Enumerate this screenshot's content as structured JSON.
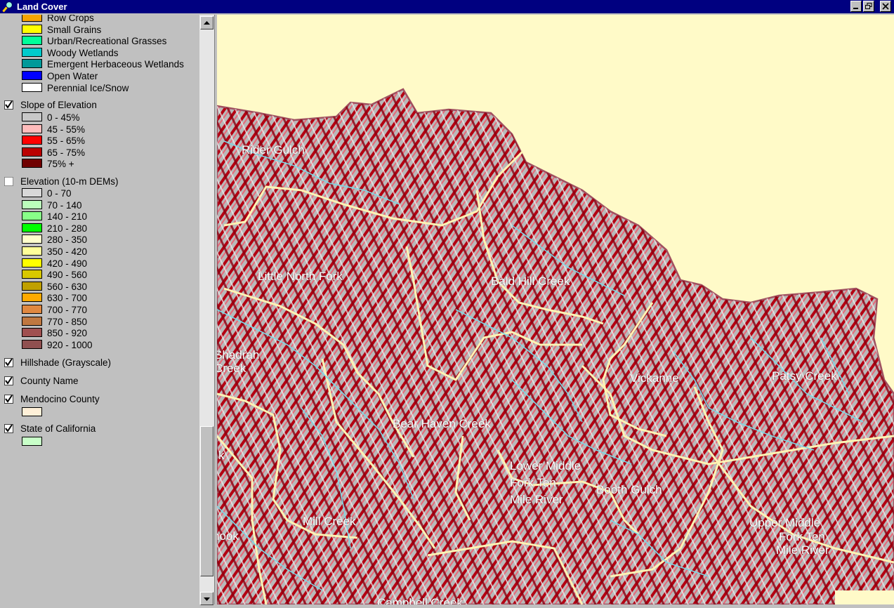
{
  "window": {
    "title": "Land Cover",
    "buttons": [
      "minimize",
      "restore",
      "close"
    ]
  },
  "legend": {
    "land_cover_classes": [
      {
        "label": "Row Crops",
        "color": "#f7a400"
      },
      {
        "label": "Small Grains",
        "color": "#ffff00"
      },
      {
        "label": "Urban/Recreational Grasses",
        "color": "#00ff99"
      },
      {
        "label": "Woody Wetlands",
        "color": "#00cccc"
      },
      {
        "label": "Emergent Herbaceous Wetlands",
        "color": "#009999"
      },
      {
        "label": "Open Water",
        "color": "#0000ff"
      },
      {
        "label": "Perennial Ice/Snow",
        "color": "#ffffff"
      }
    ],
    "layers": [
      {
        "name": "Slope of Elevation",
        "checked": true,
        "classes": [
          {
            "label": "0 - 45%",
            "color": "#c8c8c8"
          },
          {
            "label": "45 - 55%",
            "color": "#ffbcbc"
          },
          {
            "label": "55 - 65%",
            "color": "#ff0000"
          },
          {
            "label": "65 - 75%",
            "color": "#bb0000"
          },
          {
            "label": "75% +",
            "color": "#700000"
          }
        ]
      },
      {
        "name": "Elevation (10-m DEMs)",
        "checked": false,
        "classes": [
          {
            "label": "0 - 70",
            "color": "#d8d8d8"
          },
          {
            "label": "70 - 140",
            "color": "#bbffbb"
          },
          {
            "label": "140 - 210",
            "color": "#88ff88"
          },
          {
            "label": "210 - 280",
            "color": "#00ff00"
          },
          {
            "label": "280 - 350",
            "color": "#ffffcc"
          },
          {
            "label": "350 - 420",
            "color": "#ffff99"
          },
          {
            "label": "420 - 490",
            "color": "#ffff00"
          },
          {
            "label": "490 - 560",
            "color": "#d8c800"
          },
          {
            "label": "560 - 630",
            "color": "#c0a000"
          },
          {
            "label": "630 - 700",
            "color": "#ffaa00"
          },
          {
            "label": "700 - 770",
            "color": "#e08840"
          },
          {
            "label": "770 - 850",
            "color": "#c07840"
          },
          {
            "label": "850 - 920",
            "color": "#a05050"
          },
          {
            "label": "920 - 1000",
            "color": "#905050"
          }
        ]
      },
      {
        "name": "Hillshade (Grayscale)",
        "checked": true,
        "classes": []
      },
      {
        "name": "County Name",
        "checked": true,
        "classes": []
      },
      {
        "name": "Mendocino County",
        "checked": true,
        "classes": [
          {
            "label": "",
            "color": "#fff0d8"
          }
        ]
      },
      {
        "name": "State of California",
        "checked": true,
        "classes": [
          {
            "label": "",
            "color": "#c8ffc8"
          }
        ]
      }
    ]
  },
  "map": {
    "background_color": "#fffac8",
    "labels": [
      "Rider Gulch",
      "Little North Fork",
      "Bald Hill Creek",
      "Shadrah",
      "Creek",
      "Vickanne",
      "Patsy Creek",
      "Bear Haven Creek",
      "k",
      "Lower Middle",
      "Fork Ten",
      "Mile River",
      "Booth Gulch",
      "Mill Creek",
      "hook",
      "Upper Middle",
      "Fork Ten",
      "Mile River",
      "Campbell Creek"
    ]
  }
}
